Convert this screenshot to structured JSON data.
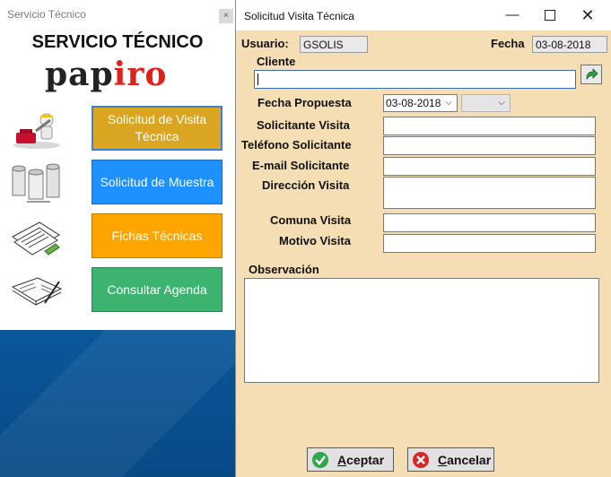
{
  "left_window": {
    "title": "Servicio Técnico",
    "close_glyph": "×",
    "heading": "SERVICIO TÉCNICO",
    "logo": {
      "part1": "pap",
      "part2": "iro"
    },
    "menu": [
      {
        "label": "Solicitud de Visita Técnica",
        "color": "#daa520",
        "icon": "technician-icon",
        "selected": true
      },
      {
        "label": "Solicitud de Muestra",
        "color": "#1e90ff",
        "icon": "paper-rolls-icon",
        "selected": false
      },
      {
        "label": "Fichas Técnicas",
        "color": "#ffa500",
        "icon": "documents-icon",
        "selected": false
      },
      {
        "label": "Consultar Agenda",
        "color": "#3cb371",
        "icon": "agenda-icon",
        "selected": false
      }
    ]
  },
  "dialog": {
    "title": "Solicitud Visita Técnica",
    "window_controls": {
      "minimize": "—",
      "close": "✕"
    },
    "usuario_label": "Usuario:",
    "usuario_value": "GSOLIS",
    "fecha_label": "Fecha",
    "fecha_value": "03-08-2018",
    "cliente_label": "Cliente",
    "cliente_value": "",
    "fecha_propuesta_label": "Fecha Propuesta",
    "fecha_propuesta_value": "03-08-2018",
    "hora_value": "",
    "solicitante_label": "Solicitante Visita",
    "telefono_label": "Teléfono Solicitante",
    "email_label": "E-mail Solicitante",
    "direccion_label": "Dirección Visita",
    "comuna_label": "Comuna Visita",
    "motivo_label": "Motivo Visita",
    "observacion_label": "Observación",
    "accept_label_u": "A",
    "accept_label_rest": "ceptar",
    "cancel_label_u": "C",
    "cancel_label_rest": "ancelar",
    "accent_bg": "#f5deb3"
  }
}
